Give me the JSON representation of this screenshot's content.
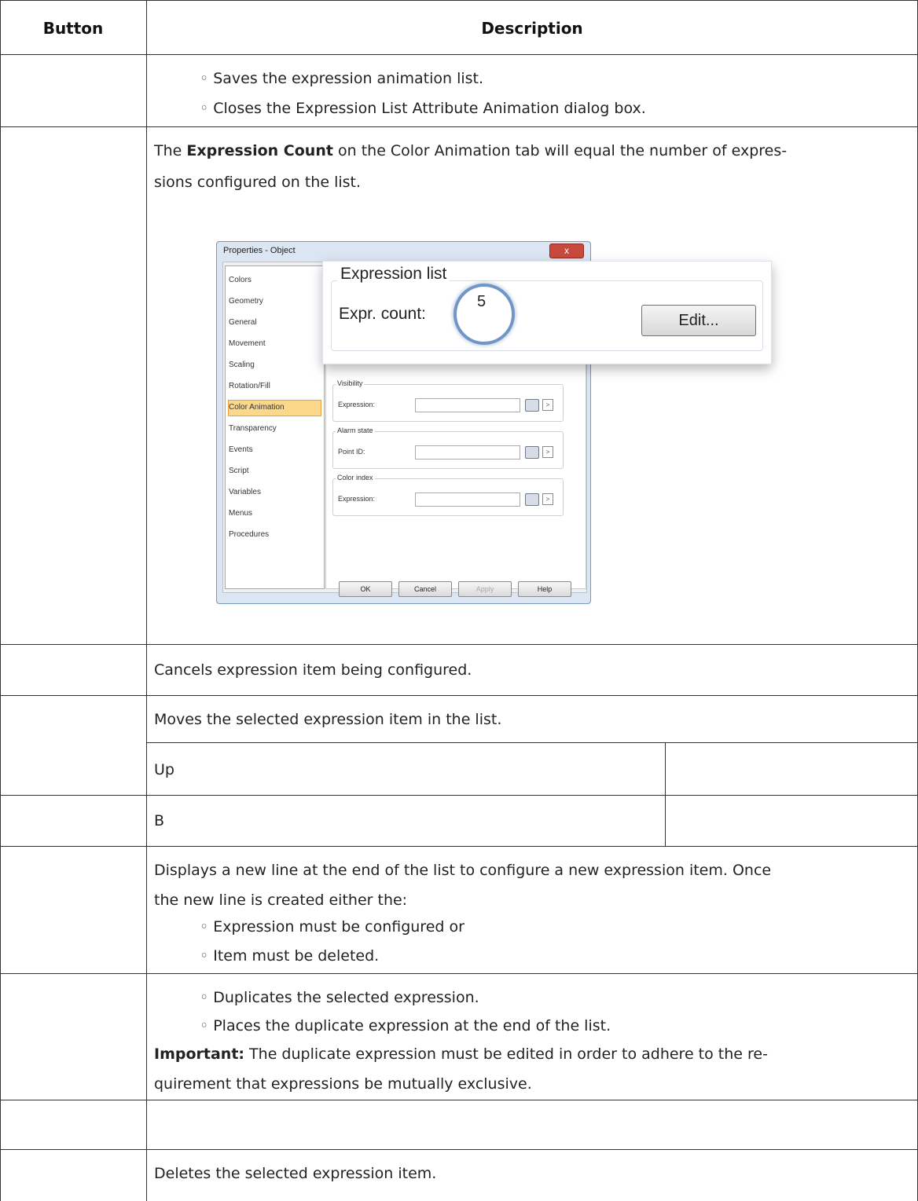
{
  "table": {
    "headers": {
      "button": "Button",
      "description": "Description"
    },
    "rows": {
      "save": {
        "bullets": [
          "Saves the expression animation list.",
          "Closes the Expression List Attribute Animation dialog box."
        ]
      },
      "count": {
        "line1_pre": "The ",
        "line1_bold": "Expression Count",
        "line1_post": " on the Color Animation tab will equal the number of expres-",
        "line2": "sions configured on the list."
      },
      "cancel": {
        "text": "Cancels expression item being configured."
      },
      "move": {
        "text": "Moves the selected expression item in the list.",
        "sub1": "Up",
        "sub2": "B"
      },
      "new": {
        "line1": "Displays a new line at the end of the list to configure a new expression item. Once",
        "line2": "the new line is created either the:",
        "bullets": [
          "Expression must be configured or",
          "Item must be deleted."
        ]
      },
      "duplicate": {
        "bullets": [
          "Duplicates the selected expression.",
          "Places the duplicate expression at the end of the list."
        ],
        "important_label": "Important:",
        "important_line1": " The duplicate expression must be edited in order to adhere to the re-",
        "important_line2": "quirement that expressions be mutually exclusive."
      },
      "delete": {
        "text": "Deletes the selected expression item."
      }
    }
  },
  "dialog": {
    "title": "Properties - Object",
    "close": "x",
    "nav_items": [
      "Colors",
      "Geometry",
      "General",
      "Movement",
      "Scaling",
      "Rotation/Fill",
      "Color Animation",
      "Transparency",
      "Events",
      "Script",
      "Variables",
      "Menus",
      "Procedures"
    ],
    "selected_nav": "Color Animation",
    "groups": {
      "visibility": {
        "title": "Visibility",
        "field": "Expression:"
      },
      "alarm": {
        "title": "Alarm state",
        "field": "Point ID:"
      },
      "color_index": {
        "title": "Color index",
        "field": "Expression:"
      }
    },
    "buttons": {
      "ok": "OK",
      "cancel": "Cancel",
      "apply": "Apply",
      "help": "Help"
    },
    "arrow": ">",
    "callout": {
      "title": "Expression list",
      "label": "Expr. count:",
      "count": "5",
      "edit": "Edit..."
    }
  }
}
